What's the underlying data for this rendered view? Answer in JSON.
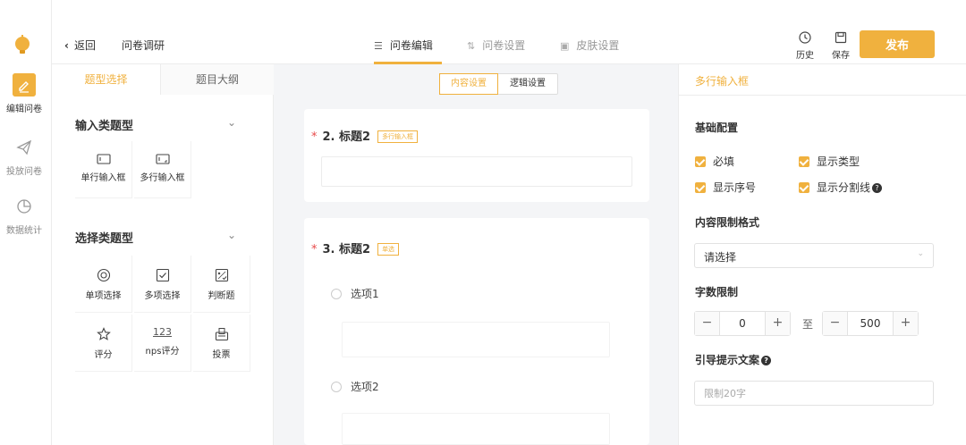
{
  "colors": {
    "accent": "#f0b13e",
    "required_star": "#e84a4a"
  },
  "rail": {
    "logo_icon": "bulb-logo-icon",
    "items": [
      {
        "label": "编辑问卷",
        "icon": "pencil-icon",
        "active": true
      },
      {
        "label": "投放问卷",
        "icon": "send-icon",
        "active": false
      },
      {
        "label": "数据统计",
        "icon": "pie-chart-icon",
        "active": false
      }
    ]
  },
  "header": {
    "back_label": "返回",
    "title": "问卷调研",
    "tabs": [
      {
        "label": "问卷编辑",
        "icon": "list-icon",
        "active": true
      },
      {
        "label": "问卷设置",
        "icon": "sliders-icon",
        "active": false
      },
      {
        "label": "皮肤设置",
        "icon": "skin-icon",
        "active": false
      }
    ],
    "history_label": "历史",
    "save_label": "保存",
    "publish_label": "发布"
  },
  "left_panel": {
    "tabs": [
      "题型选择",
      "题目大纲"
    ],
    "input_section": {
      "title": "输入类题型",
      "items": [
        {
          "label": "单行输入框",
          "icon": "single-line-input-icon"
        },
        {
          "label": "多行输入框",
          "icon": "multi-line-input-icon"
        }
      ]
    },
    "choice_section": {
      "title": "选择类题型",
      "items": [
        {
          "label": "单项选择",
          "icon": "radio-icon"
        },
        {
          "label": "多项选择",
          "icon": "checkbox-icon"
        },
        {
          "label": "判断题",
          "icon": "judge-icon"
        },
        {
          "label": "评分",
          "icon": "star-icon"
        },
        {
          "label": "nps评分",
          "icon": "nps-icon",
          "glyph": "123"
        },
        {
          "label": "投票",
          "icon": "vote-icon"
        }
      ]
    }
  },
  "canvas": {
    "tabs": [
      "内容设置",
      "逻辑设置"
    ],
    "questions": [
      {
        "star": "*",
        "title": "2. 标题2",
        "tag": "多行输入框"
      },
      {
        "star": "*",
        "title": "3. 标题2",
        "tag": "单选",
        "options": [
          "选项1",
          "选项2"
        ]
      }
    ]
  },
  "right_panel": {
    "title": "多行输入框",
    "basic_config": {
      "title": "基础配置",
      "checks": [
        {
          "label": "必填",
          "checked": true
        },
        {
          "label": "显示类型",
          "checked": true
        },
        {
          "label": "显示序号",
          "checked": true
        },
        {
          "label": "显示分割线",
          "checked": true,
          "help": true
        }
      ]
    },
    "format": {
      "title": "内容限制格式",
      "value": "请选择"
    },
    "word_limit": {
      "title": "字数限制",
      "min": "0",
      "max": "500",
      "to": "至"
    },
    "hint": {
      "title": "引导提示文案",
      "placeholder": "限制20字"
    }
  }
}
